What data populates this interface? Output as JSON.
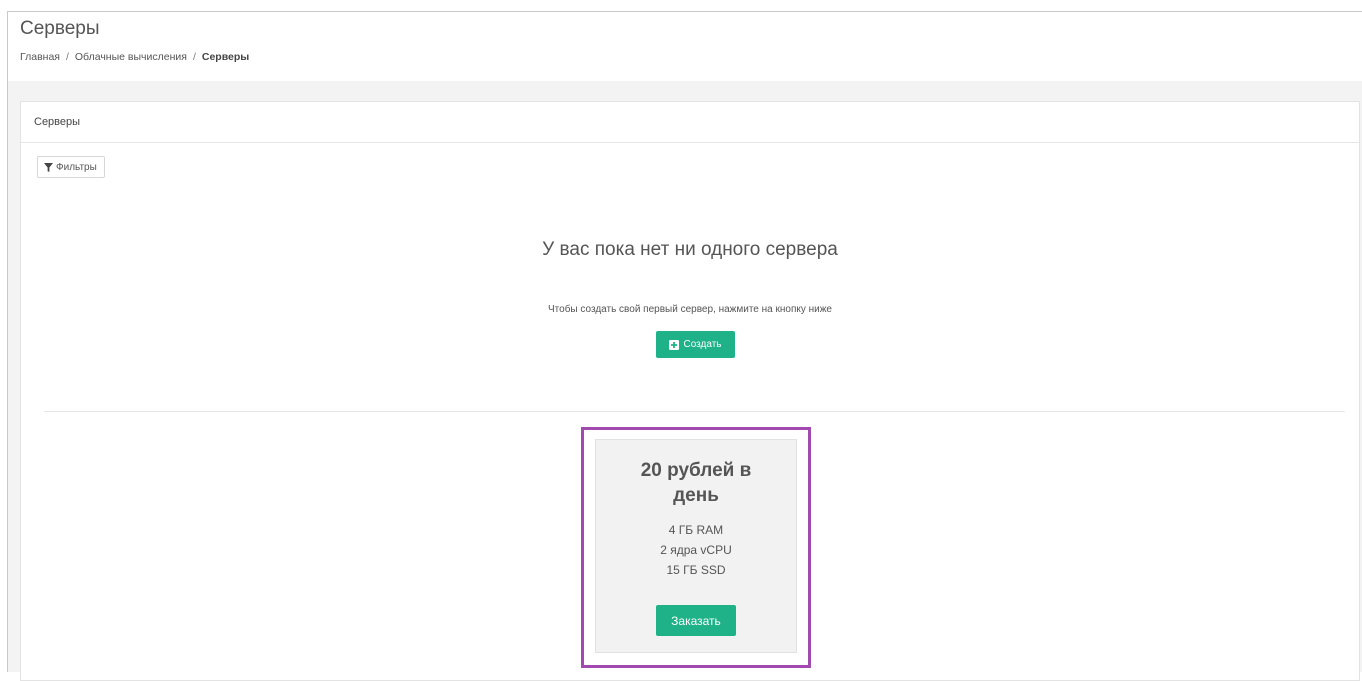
{
  "header": {
    "title": "Серверы",
    "breadcrumb": {
      "home": "Главная",
      "section": "Облачные вычисления",
      "current": "Серверы",
      "separator": "/"
    }
  },
  "panel": {
    "title": "Серверы",
    "filter_label": "Фильтры",
    "empty_title": "У вас пока нет ни одного сервера",
    "empty_hint": "Чтобы создать свой первый сервер, нажмите на кнопку ниже",
    "create_label": "Создать"
  },
  "tariff": {
    "price": "20 рублей в день",
    "specs": [
      "4 ГБ RAM",
      "2 ядра vCPU",
      "15 ГБ SSD"
    ],
    "order_label": "Заказать"
  },
  "colors": {
    "accent": "#1fb288",
    "highlight": "#a24ab0"
  },
  "icons": {
    "filter": "filter-icon",
    "create": "plus-square-icon"
  }
}
